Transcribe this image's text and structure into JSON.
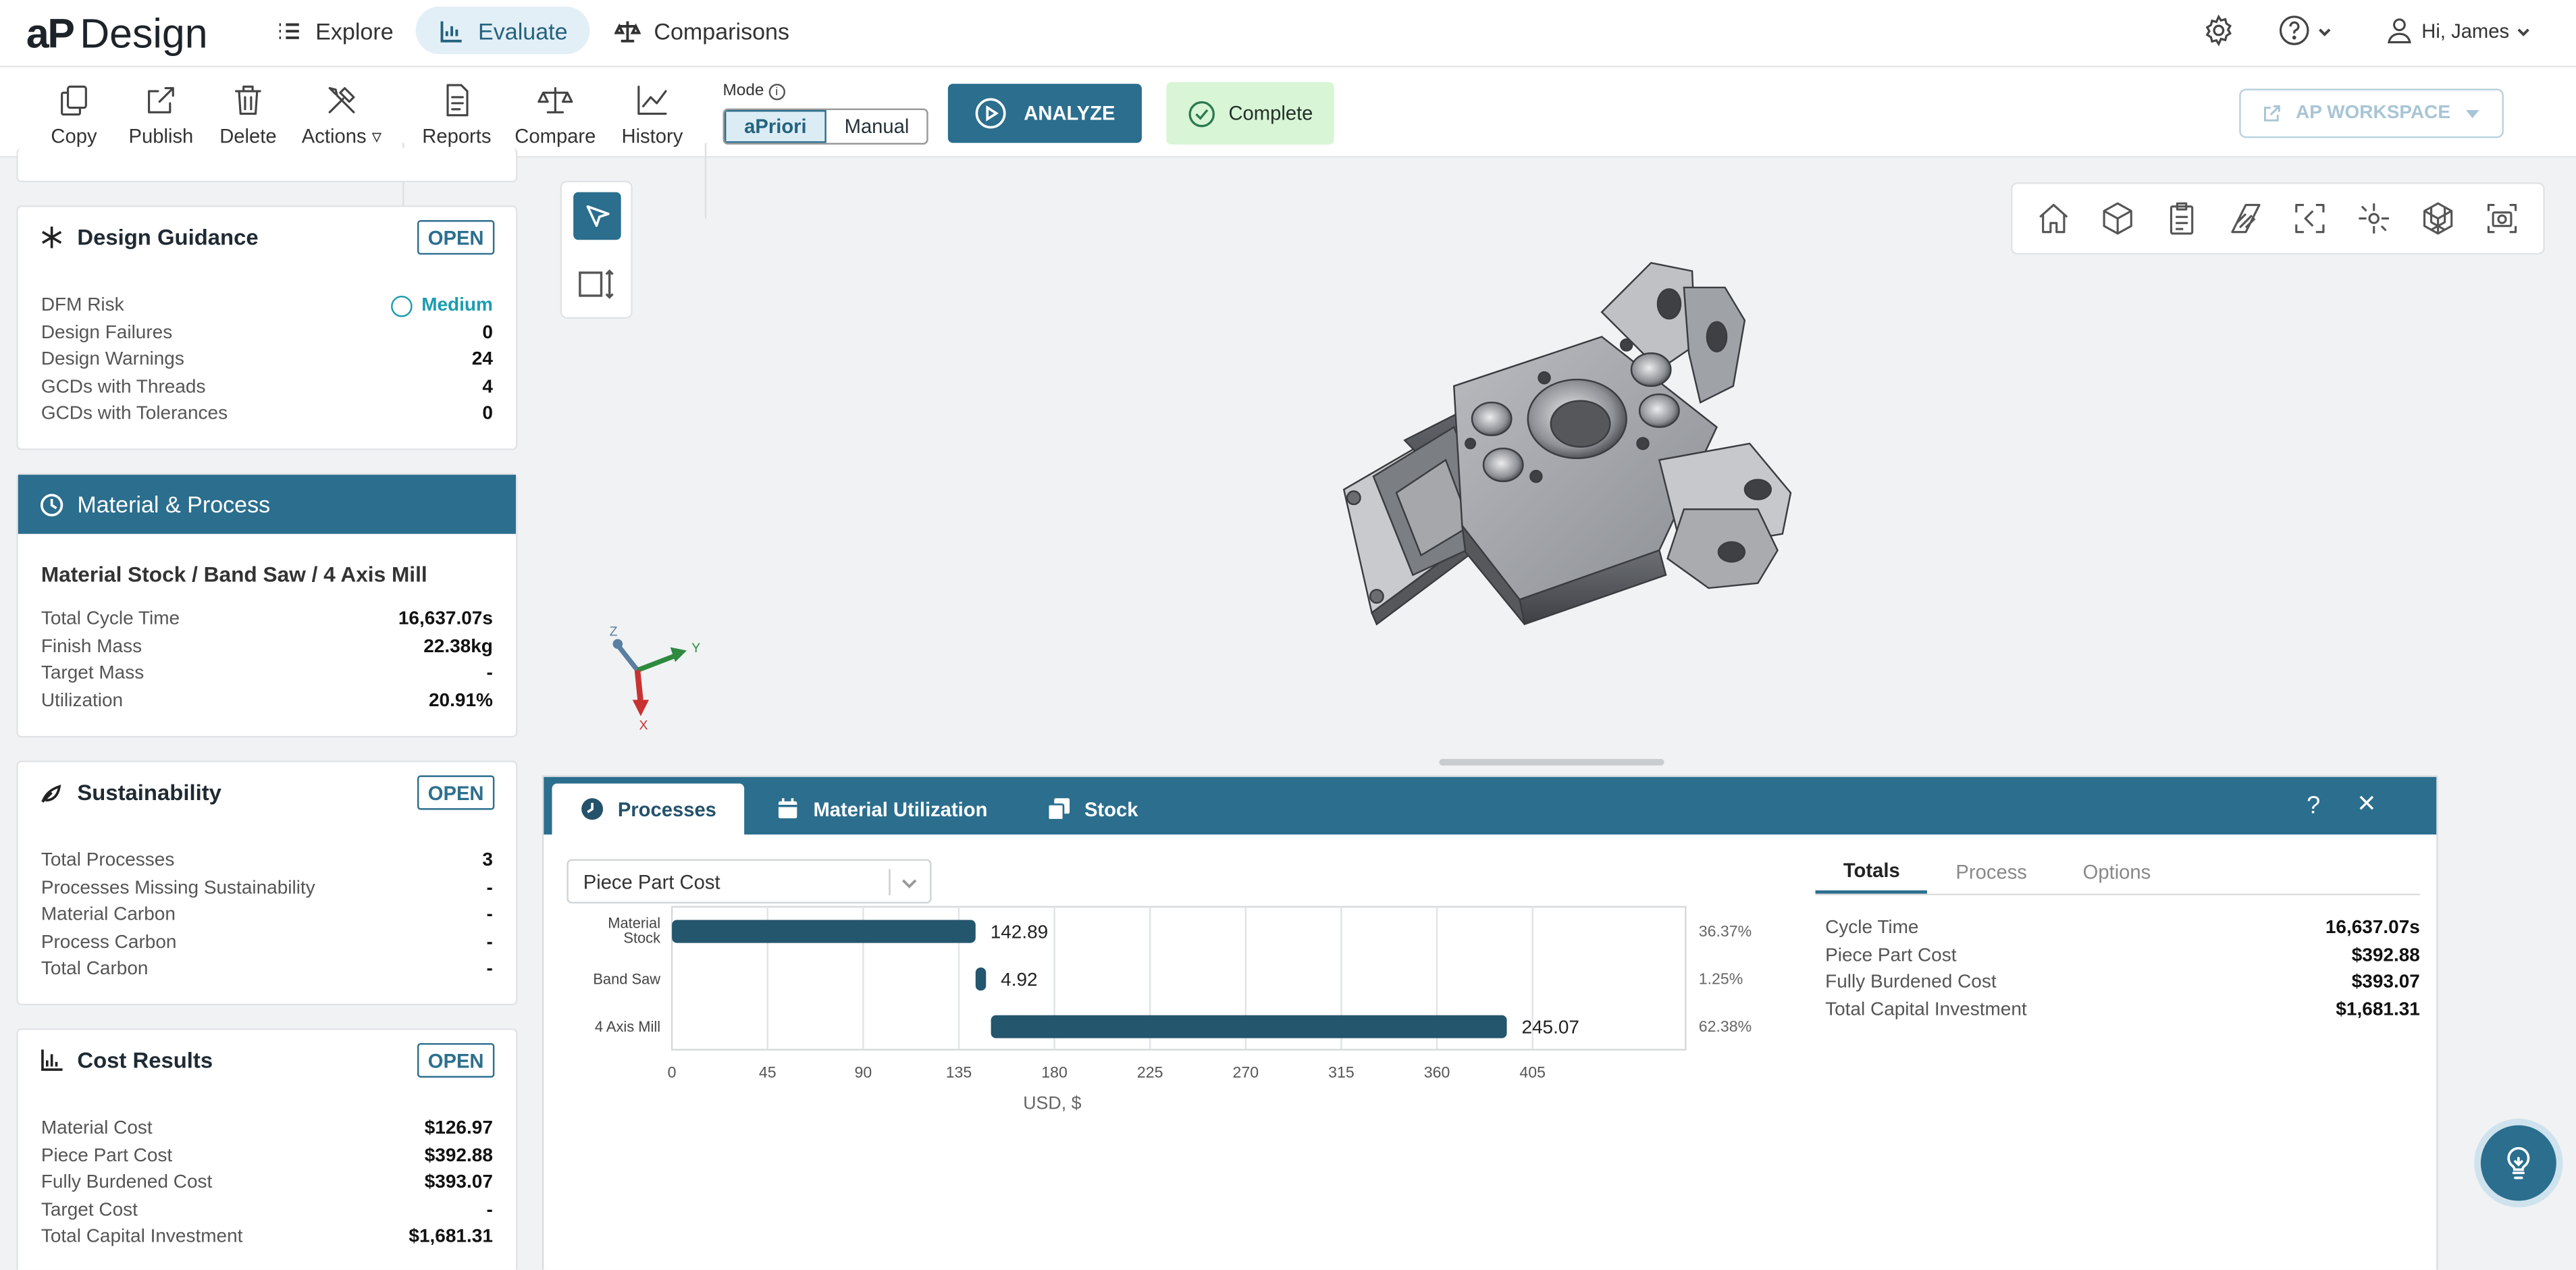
{
  "app": {
    "logo_ap": "aP",
    "logo_name": "Design"
  },
  "nav": {
    "tabs": [
      {
        "label": "Explore",
        "icon": "list-icon"
      },
      {
        "label": "Evaluate",
        "icon": "evaluate-icon",
        "active": true
      },
      {
        "label": "Comparisons",
        "icon": "scales-icon"
      }
    ],
    "user_greeting": "Hi, James"
  },
  "toolbar": {
    "buttons": [
      "Copy",
      "Publish",
      "Delete",
      "Actions",
      "Reports",
      "Compare",
      "History"
    ],
    "mode_label": "Mode",
    "mode_options": [
      "aPriori",
      "Manual"
    ],
    "mode_selected": "aPriori",
    "analyze_label": "ANALYZE",
    "status_label": "Complete",
    "workspace_label": "AP WORKSPACE"
  },
  "design_guidance": {
    "title": "Design Guidance",
    "open_label": "OPEN",
    "dfm_risk_label": "DFM Risk",
    "dfm_risk_value": "Medium",
    "rows": [
      {
        "label": "Design Failures",
        "value": "0"
      },
      {
        "label": "Design Warnings",
        "value": "24"
      },
      {
        "label": "GCDs with Threads",
        "value": "4"
      },
      {
        "label": "GCDs with Tolerances",
        "value": "0"
      }
    ]
  },
  "material_process": {
    "title": "Material & Process",
    "routing": "Material Stock / Band Saw / 4 Axis Mill",
    "rows": [
      {
        "label": "Total Cycle Time",
        "value": "16,637.07s"
      },
      {
        "label": "Finish Mass",
        "value": "22.38kg"
      },
      {
        "label": "Target Mass",
        "value": "-"
      },
      {
        "label": "Utilization",
        "value": "20.91%"
      }
    ]
  },
  "sustainability": {
    "title": "Sustainability",
    "open_label": "OPEN",
    "rows": [
      {
        "label": "Total Processes",
        "value": "3"
      },
      {
        "label": "Processes Missing Sustainability",
        "value": "-"
      },
      {
        "label": "Material Carbon",
        "value": "-"
      },
      {
        "label": "Process Carbon",
        "value": "-"
      },
      {
        "label": "Total Carbon",
        "value": "-"
      }
    ]
  },
  "cost_results": {
    "title": "Cost Results",
    "open_label": "OPEN",
    "rows": [
      {
        "label": "Material Cost",
        "value": "$126.97"
      },
      {
        "label": "Piece Part Cost",
        "value": "$392.88"
      },
      {
        "label": "Fully Burdened Cost",
        "value": "$393.07"
      },
      {
        "label": "Target Cost",
        "value": "-"
      },
      {
        "label": "Total Capital Investment",
        "value": "$1,681.31"
      }
    ]
  },
  "viewer": {
    "axes": {
      "x": "X",
      "y": "Y",
      "z": "Z"
    },
    "tools": [
      "home-icon",
      "cube-icon",
      "clipboard-icon",
      "section-icon",
      "fit-icon",
      "explode-icon",
      "grid-cube-icon",
      "camera-icon"
    ]
  },
  "panel": {
    "tabs": [
      "Processes",
      "Material Utilization",
      "Stock"
    ],
    "help_label": "?",
    "close_label": "×",
    "metric_select": "Piece Part Cost",
    "right_tabs": [
      "Totals",
      "Process",
      "Options"
    ],
    "totals": [
      {
        "label": "Cycle Time",
        "value": "16,637.07s"
      },
      {
        "label": "Piece Part Cost",
        "value": "$392.88"
      },
      {
        "label": "Fully Burdened Cost",
        "value": "$393.07"
      },
      {
        "label": "Total Capital Investment",
        "value": "$1,681.31"
      }
    ]
  },
  "colors": {
    "primary": "#2b6e8e",
    "bar": "#24566e",
    "status_bg": "#d8f5d5",
    "risk_medium": "#1b9cb0"
  },
  "chart_data": {
    "type": "bar",
    "orientation": "horizontal",
    "stacked_waterfall": true,
    "categories": [
      "Material Stock",
      "Band Saw",
      "4 Axis Mill"
    ],
    "values": [
      142.89,
      4.92,
      245.07
    ],
    "starts": [
      0,
      142.89,
      147.81
    ],
    "value_labels": [
      "142.89",
      "4.92",
      "245.07"
    ],
    "percent_labels": [
      "36.37%",
      "1.25%",
      "62.38%"
    ],
    "xlabel": "USD, $",
    "xticks": [
      0,
      45,
      90,
      135,
      180,
      225,
      270,
      315,
      360,
      405
    ],
    "xlim": [
      0,
      477
    ],
    "grid": true
  }
}
